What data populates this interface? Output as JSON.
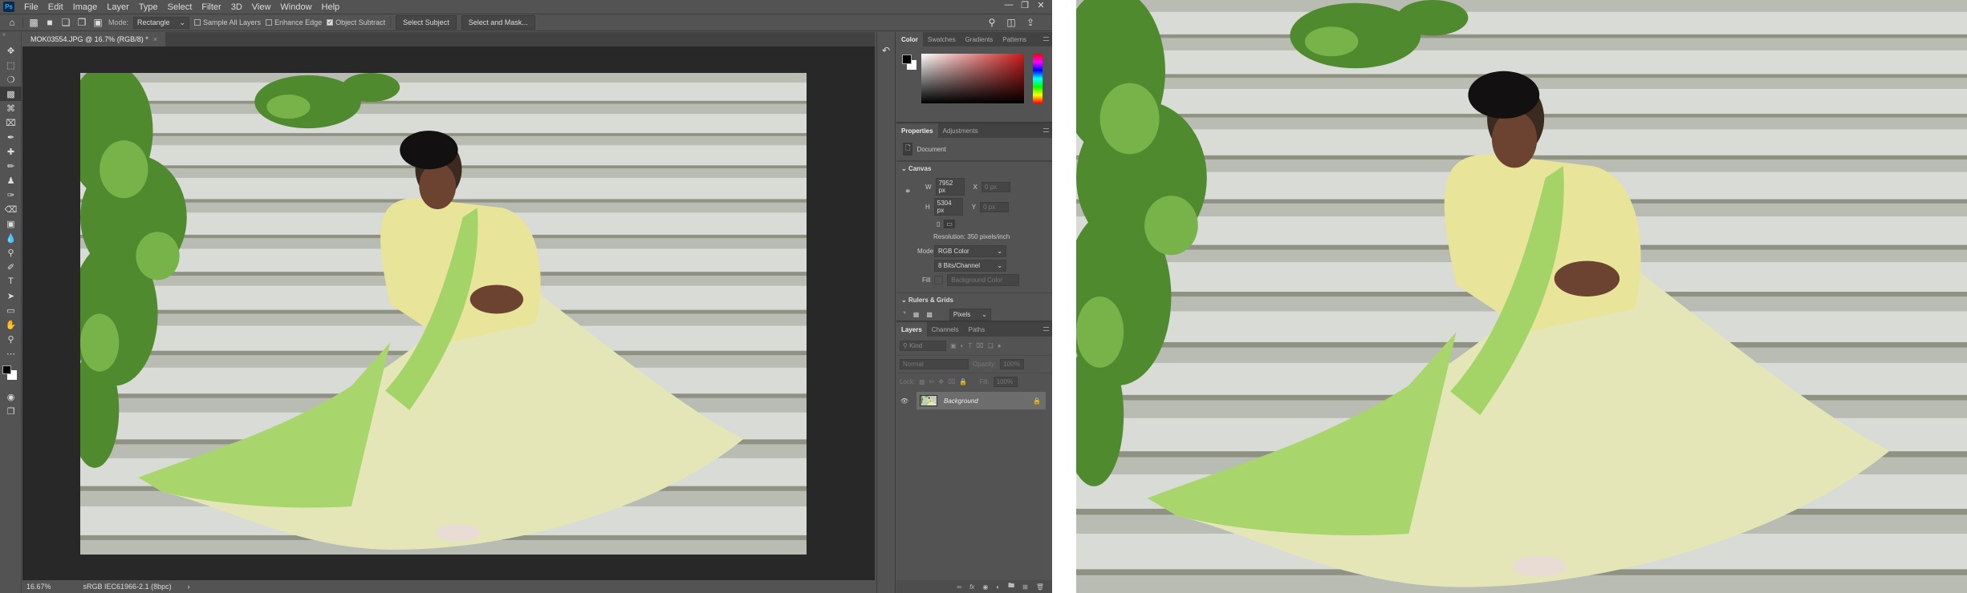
{
  "app": {
    "logo": "Ps",
    "menus": [
      "File",
      "Edit",
      "Image",
      "Layer",
      "Type",
      "Select",
      "Filter",
      "3D",
      "View",
      "Window",
      "Help"
    ],
    "window_controls": [
      "minimize-icon",
      "restore-icon",
      "close-icon"
    ]
  },
  "options": {
    "mode_label": "Mode:",
    "mode_value": "Rectangle",
    "sample_all_layers": "Sample All Layers",
    "sample_all_layers_checked": false,
    "enhance_edge": "Enhance Edge",
    "enhance_edge_checked": false,
    "object_subtract": "Object Subtract",
    "object_subtract_checked": true,
    "select_subject": "Select Subject",
    "select_and_mask": "Select and Mask..."
  },
  "document": {
    "tab_title": "MOK03554.JPG @ 16.7% (RGB/8) *",
    "close": "×"
  },
  "tools": [
    "move",
    "marquee",
    "lasso",
    "object-selection",
    "crop",
    "frame",
    "eyedropper",
    "healing",
    "brush",
    "stamp",
    "history-brush",
    "eraser",
    "gradient",
    "blur",
    "dodge",
    "pen",
    "type",
    "path-selection",
    "rectangle",
    "hand",
    "zoom",
    "more"
  ],
  "status": {
    "zoom": "16.67%",
    "profile": "sRGB IEC61966-2.1 (8bpc)",
    "arrow": "›"
  },
  "color_panel": {
    "tabs": [
      "Color",
      "Swatches",
      "Gradients",
      "Patterns"
    ],
    "active": 0,
    "foreground": "#000000",
    "background": "#ffffff",
    "hue": "#cc1a1a"
  },
  "properties": {
    "tabs": [
      "Properties",
      "Adjustments"
    ],
    "doc_label": "Document",
    "canvas_title": "Canvas",
    "w_label": "W",
    "w": "7952 px",
    "h_label": "H",
    "h": "5304 px",
    "x_label": "X",
    "x": "0 px",
    "y_label": "Y",
    "y": "0 px",
    "resolution": "Resolution: 350 pixels/inch",
    "mode_label": "Mode",
    "mode": "RGB Color",
    "bits": "8 Bits/Channel",
    "fill_label": "Fill",
    "fill": "Background Color",
    "rulers_title": "Rulers & Grids",
    "units": "Pixels"
  },
  "layers": {
    "tabs": [
      "Layers",
      "Channels",
      "Paths"
    ],
    "filter": "Kind",
    "blend": "Normal",
    "opacity_label": "Opacity:",
    "opacity": "100%",
    "lock_label": "Lock:",
    "fill_label": "Fill:",
    "fill": "100%",
    "items": [
      {
        "name": "Background",
        "visible": true,
        "locked": true
      }
    ]
  }
}
